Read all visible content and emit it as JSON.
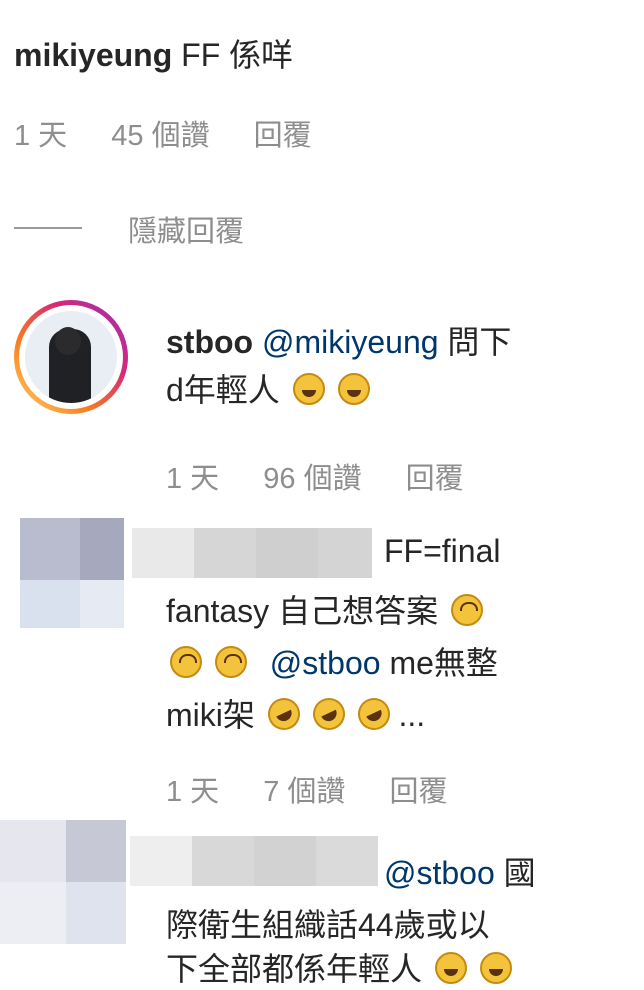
{
  "top_comment": {
    "username": "mikiyeung",
    "text": "FF 係咩",
    "time": "1 天",
    "likes": "45 個讚",
    "reply": "回覆"
  },
  "hide_replies": "隱藏回覆",
  "reply1": {
    "username": "stboo",
    "mention": "@mikiyeung",
    "text_line1": "問下",
    "text_line2": "d年輕人",
    "emojis": [
      "laughing-emoji",
      "laughing-emoji"
    ],
    "time": "1 天",
    "likes": "96 個讚",
    "reply": "回覆"
  },
  "reply2": {
    "line1": "FF=final",
    "line2": "fantasy 自己想答案",
    "mention": "@stboo",
    "line3_text": "me無整",
    "line4_text": "miki架",
    "line4_end": "...",
    "time": "1 天",
    "likes": "7 個讚",
    "reply": "回覆"
  },
  "reply3": {
    "mention": "@stboo",
    "line1_end": "國",
    "line2": "際衛生組織話44歲或以",
    "line3": "下全部都係年輕人"
  },
  "colors": {
    "text": "#262626",
    "meta": "#8e8e8e",
    "mention": "#00376b",
    "avatar_ring": "#d6249f"
  }
}
